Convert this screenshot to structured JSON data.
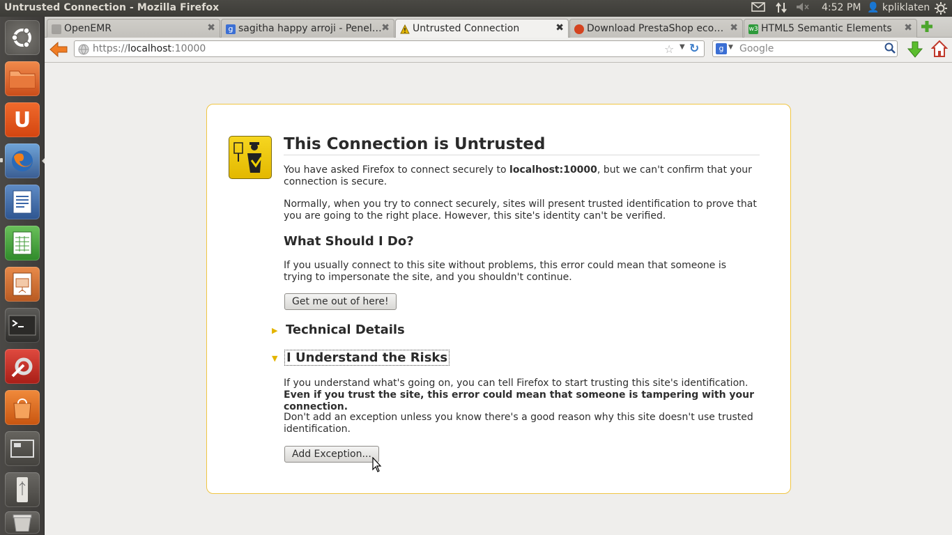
{
  "topbar": {
    "window_title": "Untrusted Connection - Mozilla Firefox",
    "time": "4:52 PM",
    "user": "kpliklaten"
  },
  "launcher": {
    "items": [
      "Dash home",
      "Files",
      "Ubuntu One",
      "Firefox",
      "LibreOffice Writer",
      "LibreOffice Calc",
      "LibreOffice Impress",
      "Terminal",
      "System Settings",
      "Ubuntu Software Center",
      "Workspace Switcher",
      "USB Drive",
      "Trash"
    ]
  },
  "tabs": [
    {
      "label": "OpenEMR",
      "favicon": "page-icon",
      "color": "#6c6a66"
    },
    {
      "label": "sagitha happy arroji - Penel…",
      "favicon": "google-icon",
      "color": "#3b6fd4"
    },
    {
      "label": "Untrusted Connection",
      "favicon": "warning-icon",
      "color": "#e6b800"
    },
    {
      "label": "Download PrestaShop eco…",
      "favicon": "prestashop-icon",
      "color": "#d4431f"
    },
    {
      "label": "HTML5 Semantic Elements",
      "favicon": "w3-icon",
      "color": "#2e9a3b"
    }
  ],
  "nav": {
    "url_proto": "https://",
    "url_host": "localhost",
    "url_rest": ":10000",
    "search_placeholder": "Google"
  },
  "page": {
    "title": "This Connection is Untrusted",
    "intro_a": "You have asked Firefox to connect securely to ",
    "intro_host": "localhost:10000",
    "intro_b": ", but we can't confirm that your connection is secure.",
    "normally": "Normally, when you try to connect securely, sites will present trusted identification to prove that you are going to the right place. However, this site's identity can't be verified.",
    "what_heading": "What Should I Do?",
    "what_text": "If you usually connect to this site without problems, this error could mean that someone is trying to impersonate the site, and you shouldn't continue.",
    "get_out_button": "Get me out of here!",
    "tech_heading": "Technical Details",
    "risks_heading": "I Understand the Risks",
    "risks_text_a": "If you understand what's going on, you can tell Firefox to start trusting this site's identification. ",
    "risks_text_b": "Even if you trust the site, this error could mean that someone is tampering with your connection.",
    "dont_add": "Don't add an exception unless you know there's a good reason why this site doesn't use trusted identification.",
    "add_exception_button": "Add Exception..."
  },
  "colors": {
    "accent": "#f0c542",
    "warning": "#e6b800"
  }
}
